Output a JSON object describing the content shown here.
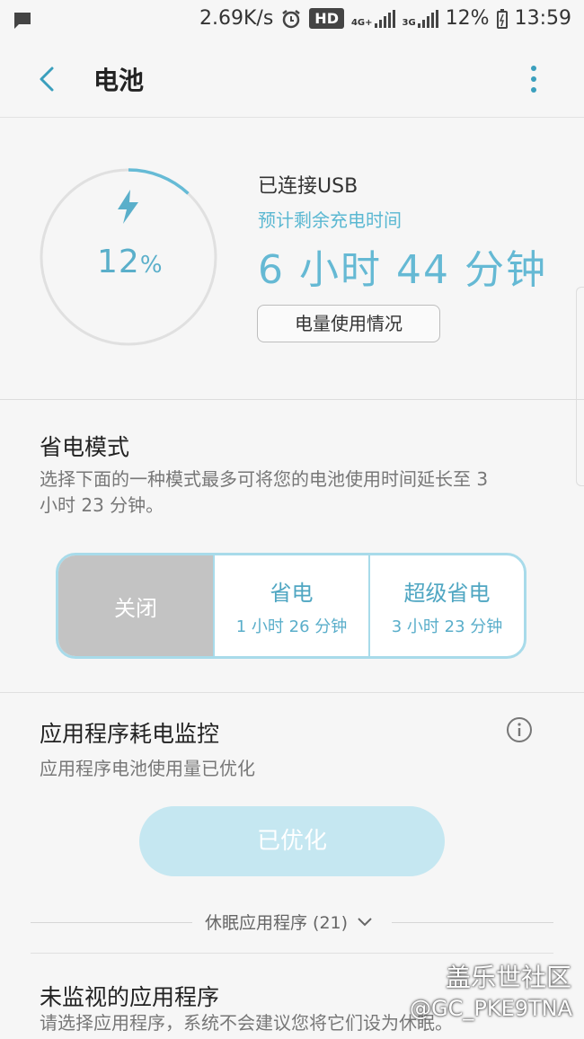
{
  "status_bar": {
    "speed": "2.69K/s",
    "hd": "HD",
    "net1": "4G+",
    "net2": "3G",
    "battery_percent": "12%",
    "time": "13:59"
  },
  "app_bar": {
    "title": "电池"
  },
  "battery": {
    "level_fraction": 0.12,
    "percent_value": "12",
    "percent_sign": "%",
    "connection": "已连接USB",
    "estimate_label": "预计剩余充电时间",
    "estimate_time": "6 小时 44 分钟",
    "usage_button": "电量使用情况",
    "accent_color": "#5aafca"
  },
  "power_saving": {
    "title": "省电模式",
    "description": "选择下面的一种模式最多可将您的电池使用时间延长至 3 小时 23 分钟。",
    "modes": [
      {
        "name": "关闭",
        "time": ""
      },
      {
        "name": "省电",
        "time": "1 小时 26 分钟"
      },
      {
        "name": "超级省电",
        "time": "3 小时 23 分钟"
      }
    ],
    "selected": "关闭"
  },
  "monitor": {
    "title": "应用程序耗电监控",
    "description": "应用程序电池使用量已优化",
    "optimized_button": "已优化",
    "sleeping_apps": "休眠应用程序 (21)"
  },
  "unmonitored": {
    "title": "未监视的应用程序",
    "description": "请选择应用程序，系统不会建议您将它们设为休眠。"
  },
  "watermark": {
    "brand": "盖乐世社区",
    "user": "@GC_PKE9TNA"
  }
}
